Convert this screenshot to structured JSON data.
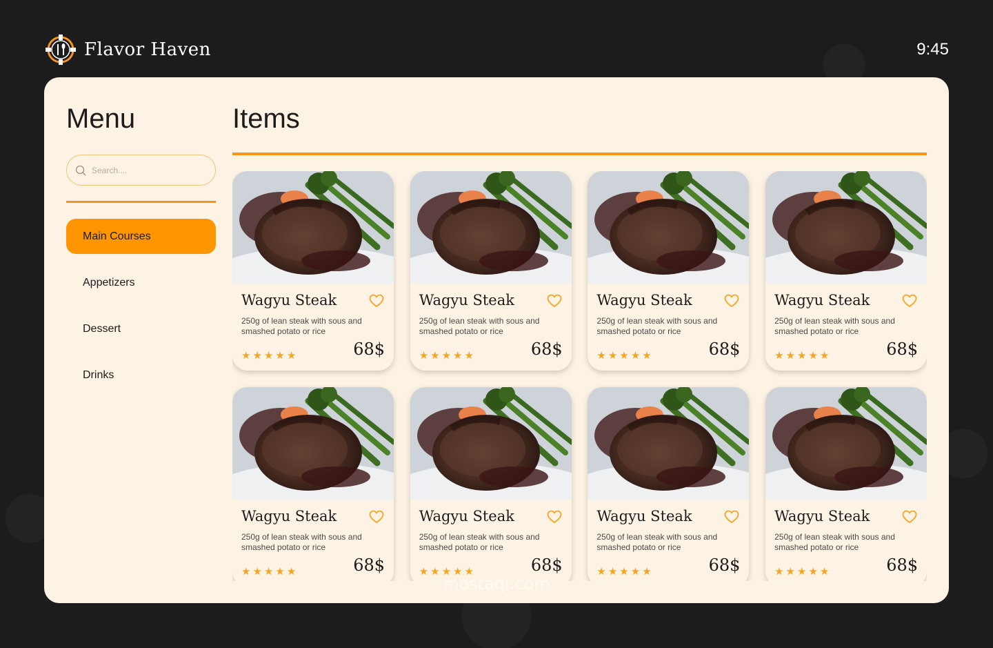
{
  "app": {
    "brand_name": "Flavor Haven",
    "clock": "9:45",
    "watermark": "mostaql.com"
  },
  "sidebar": {
    "title": "Menu",
    "search_placeholder": "Search....",
    "categories": [
      {
        "label": "Main Courses",
        "active": true
      },
      {
        "label": "Appetizers",
        "active": false
      },
      {
        "label": "Dessert",
        "active": false
      },
      {
        "label": "Drinks",
        "active": false
      }
    ]
  },
  "main": {
    "title": "Items",
    "items": [
      {
        "name": "Wagyu Steak",
        "description": "250g of lean steak with sous and smashed potato or rice",
        "price": "68$",
        "rating": 5,
        "icon": "heart-outline-icon"
      },
      {
        "name": "Wagyu Steak",
        "description": "250g of lean steak with sous and smashed potato or rice",
        "price": "68$",
        "rating": 5,
        "icon": "heart-outline-icon"
      },
      {
        "name": "Wagyu Steak",
        "description": "250g of lean steak with sous and smashed potato or rice",
        "price": "68$",
        "rating": 5,
        "icon": "heart-outline-icon"
      },
      {
        "name": "Wagyu Steak",
        "description": "250g of lean steak with sous and smashed potato or rice",
        "price": "68$",
        "rating": 5,
        "icon": "heart-outline-icon"
      },
      {
        "name": "Wagyu Steak",
        "description": "250g of lean steak with sous and smashed potato or rice",
        "price": "68$",
        "rating": 5,
        "icon": "heart-outline-icon"
      },
      {
        "name": "Wagyu Steak",
        "description": "250g of lean steak with sous and smashed potato or rice",
        "price": "68$",
        "rating": 5,
        "icon": "heart-outline-icon"
      },
      {
        "name": "Wagyu Steak",
        "description": "250g of lean steak with sous and smashed potato or rice",
        "price": "68$",
        "rating": 5,
        "icon": "heart-outline-icon"
      },
      {
        "name": "Wagyu Steak",
        "description": "250g of lean steak with sous and smashed potato or rice",
        "price": "68$",
        "rating": 5,
        "icon": "heart-outline-icon"
      }
    ]
  },
  "colors": {
    "accent": "#ff9500",
    "background": "#1c1c1c",
    "panel": "#fdf3e4",
    "star": "#f5a524"
  }
}
